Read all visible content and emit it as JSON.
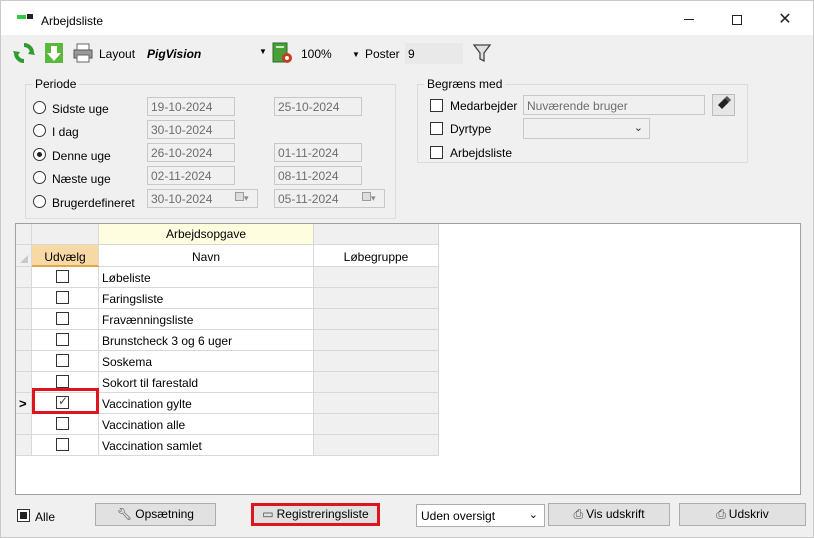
{
  "window": {
    "title": "Arbejdsliste",
    "controls": {
      "minimize": "–",
      "maximize": "□",
      "close": "✕"
    }
  },
  "toolbar": {
    "layout_label": "Layout",
    "layout_value": "PigVision",
    "zoom_value": "100%",
    "poster_label": "Poster",
    "poster_value": "9"
  },
  "periode": {
    "title": "Periode",
    "options": [
      {
        "label": "Sidste uge",
        "from": "19-10-2024",
        "to": "25-10-2024",
        "checked": false
      },
      {
        "label": "I dag",
        "from": "30-10-2024",
        "to": "",
        "checked": false
      },
      {
        "label": "Denne uge",
        "from": "26-10-2024",
        "to": "01-11-2024",
        "checked": true
      },
      {
        "label": "Næste uge",
        "from": "02-11-2024",
        "to": "08-11-2024",
        "checked": false
      },
      {
        "label": "Brugerdefineret",
        "from": "30-10-2024",
        "to": "05-11-2024",
        "checked": false
      }
    ]
  },
  "begraens": {
    "title": "Begræns med",
    "medarbejder_label": "Medarbejder",
    "medarbejder_value": "Nuværende bruger",
    "dyrtype_label": "Dyrtype",
    "dyrtype_value": "",
    "arbejdsliste_label": "Arbejdsliste"
  },
  "grid": {
    "band_header": "Arbejdsopgave",
    "col_udvaelg": "Udvælg",
    "col_navn": "Navn",
    "col_lobegruppe": "Løbegruppe",
    "current_row_marker": ">",
    "rows": [
      {
        "navn": "Løbeliste",
        "checked": false,
        "current": false
      },
      {
        "navn": "Faringsliste",
        "checked": false,
        "current": false
      },
      {
        "navn": "Fravænningsliste",
        "checked": false,
        "current": false
      },
      {
        "navn": "Brunstcheck 3 og 6 uger",
        "checked": false,
        "current": false
      },
      {
        "navn": "Soskema",
        "checked": false,
        "current": false
      },
      {
        "navn": "Sokort til farestald",
        "checked": false,
        "current": false
      },
      {
        "navn": "Vaccination gylte",
        "checked": true,
        "current": true
      },
      {
        "navn": "Vaccination alle",
        "checked": false,
        "current": false
      },
      {
        "navn": "Vaccination samlet",
        "checked": false,
        "current": false
      }
    ]
  },
  "bottom": {
    "alle_label": "Alle",
    "opsaetning_label": "Opsætning",
    "registreringsliste_label": "Registreringsliste",
    "oversigt_value": "Uden oversigt",
    "vis_udskrift_label": "Vis udskrift",
    "udskriv_label": "Udskriv"
  },
  "colors": {
    "highlight": "#e0141e",
    "selected_column": "#f7d9a5",
    "band_header": "#fffde0"
  }
}
